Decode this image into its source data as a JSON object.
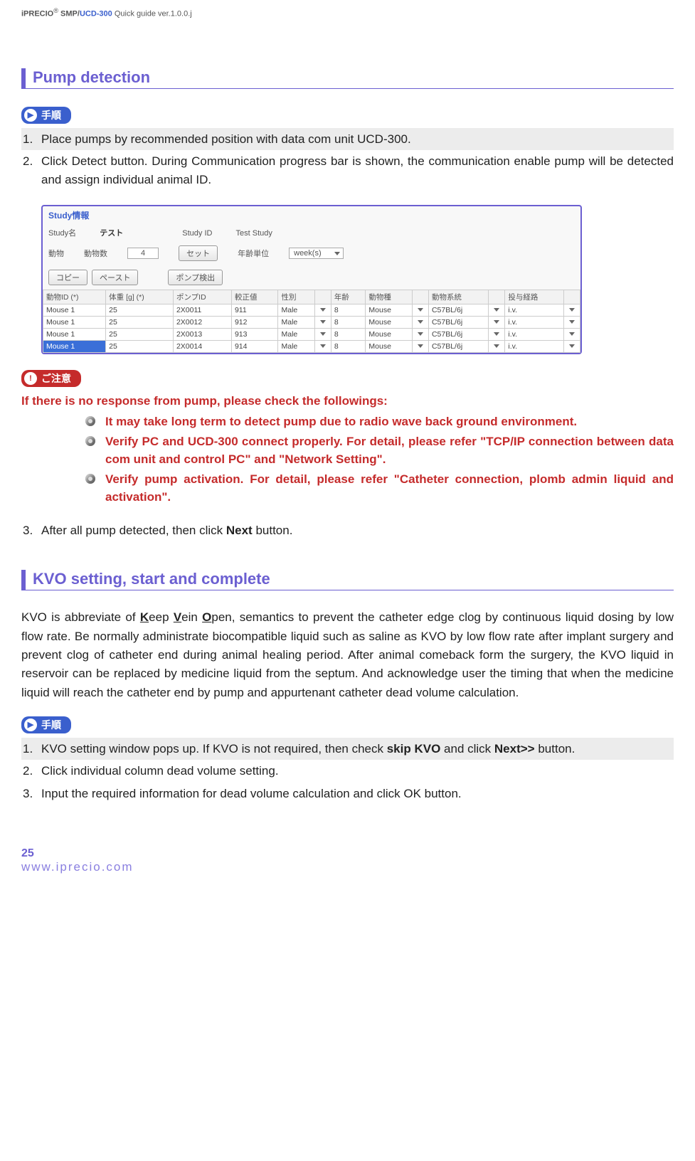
{
  "header": {
    "product_prefix": "iPRECIO",
    "product_sup": "®",
    "product_model": " SMP/",
    "product_model_blue": "UCD-300",
    "rest": " Quick guide ver.1.0.0.j"
  },
  "section1_title": "Pump detection",
  "pill_procedure_icon": "▶",
  "pill_procedure_label": "手順",
  "steps1": {
    "s1": "Place pumps by recommended position with data com unit UCD-300.",
    "s2": "Click Detect button. During Communication progress bar is shown, the communication enable pump will be detected and assign individual animal ID.",
    "s3_pre": "After all pump detected, then click ",
    "s3_bold": "Next",
    "s3_post": " button."
  },
  "screenshot": {
    "title": "Study情報",
    "row1": {
      "label1": "Study名",
      "val1": "テスト",
      "label2": "Study ID",
      "val2": "Test Study"
    },
    "row2": {
      "label1": "動物",
      "label2": "動物数",
      "countbox": "4",
      "setbtn": "セット",
      "agelabel": "年齢単位",
      "ageunit": "week(s)"
    },
    "btns": {
      "b1": "コピー",
      "b2": "ペースト",
      "b3": "ポンプ検出"
    },
    "headers": [
      "動物ID (*)",
      "体重 [g] (*)",
      "ポンプID",
      "較正値",
      "性別",
      "",
      "年齢",
      "動物種",
      "",
      "動物系統",
      "",
      "投与経路",
      ""
    ],
    "rows": [
      [
        "Mouse 1",
        "25",
        "2X0011",
        "911",
        "Male",
        "▾",
        "8",
        "Mouse",
        "▾",
        "C57BL/6j",
        "▾",
        "i.v.",
        "▾"
      ],
      [
        "Mouse 1",
        "25",
        "2X0012",
        "912",
        "Male",
        "▾",
        "8",
        "Mouse",
        "▾",
        "C57BL/6j",
        "▾",
        "i.v.",
        "▾"
      ],
      [
        "Mouse 1",
        "25",
        "2X0013",
        "913",
        "Male",
        "▾",
        "8",
        "Mouse",
        "▾",
        "C57BL/6j",
        "▾",
        "i.v.",
        "▾"
      ],
      [
        "Mouse 1",
        "25",
        "2X0014",
        "914",
        "Male",
        "▾",
        "8",
        "Mouse",
        "▾",
        "C57BL/6j",
        "▾",
        "i.v.",
        "▾"
      ]
    ]
  },
  "pill_caution_icon": "!",
  "pill_caution_label": "ご注意",
  "warn_title": "If there is no response from pump, please check the followings:",
  "bullets": {
    "b1": "It may take long term to detect pump due to radio wave back ground environment.",
    "b2_a": "Verify PC and UCD-300 connect properly. ",
    "b2_b": "For detail, please refer \"",
    "b2_c": "TCP/IP connection between data com unit and control PC",
    "b2_d": "\" and \"",
    "b2_e": "Network Setting",
    "b2_f": "\".",
    "b3_a": "Verify pump activation. ",
    "b3_b": "For detail, please refer \"",
    "b3_c": "Catheter connection, plomb admin liquid and activation",
    "b3_d": "\"."
  },
  "section2_title": "KVO setting, start and complete",
  "kvo_para_a": "KVO is abbreviate of ",
  "kvo_k": "K",
  "kvo_para_b": "eep ",
  "kvo_v": "V",
  "kvo_para_c": "ein ",
  "kvo_o": "O",
  "kvo_para_d": "pen, semantics to prevent the catheter edge clog by continuous liquid dosing by low flow rate. Be normally administrate biocompatible liquid such as saline as KVO by low flow rate after implant surgery and prevent clog of catheter end during animal healing period. After animal comeback form the surgery, the KVO liquid in reservoir can be replaced by medicine liquid from the septum. And acknowledge user the timing that when the medicine liquid will reach the catheter end by pump and appurtenant catheter dead volume calculation.",
  "steps2": {
    "s1_a": "KVO setting window pops up. If KVO is not required, then check ",
    "s1_b": "skip KVO",
    "s1_c": " and click ",
    "s1_d": "Next>>",
    "s1_e": " button.",
    "s2": "Click individual column dead volume setting.",
    "s3": "Input the required information for dead volume calculation and click OK button."
  },
  "footer": {
    "page": "25",
    "url": "www.iprecio.com"
  }
}
